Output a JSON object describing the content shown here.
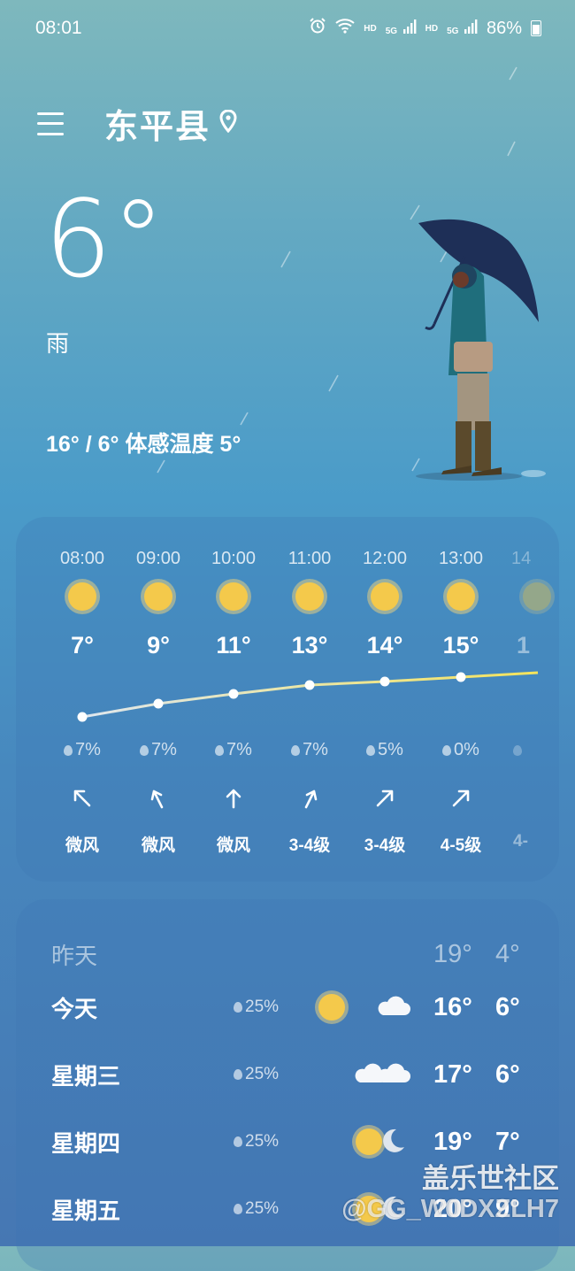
{
  "status_bar": {
    "time": "08:01",
    "hd1": "HD",
    "hd2": "HD",
    "sig1": "5G",
    "sig2": "5G",
    "battery": "86%"
  },
  "header": {
    "city": "东平县"
  },
  "current": {
    "temp": "6°",
    "condition": "雨",
    "range": "16° / 6° 体感温度 5°"
  },
  "hourly": [
    {
      "time": "08:00",
      "temp": "7°",
      "rain": "7%",
      "wind": "微风",
      "wind_dir": "northwest"
    },
    {
      "time": "09:00",
      "temp": "9°",
      "rain": "7%",
      "wind": "微风",
      "wind_dir": "north"
    },
    {
      "time": "10:00",
      "temp": "11°",
      "rain": "7%",
      "wind": "微风",
      "wind_dir": "north"
    },
    {
      "time": "11:00",
      "temp": "13°",
      "rain": "7%",
      "wind": "3-4级",
      "wind_dir": "northeast"
    },
    {
      "time": "12:00",
      "temp": "14°",
      "rain": "5%",
      "wind": "3-4级",
      "wind_dir": "northeast"
    },
    {
      "time": "13:00",
      "temp": "15°",
      "rain": "0%",
      "wind": "4-5级",
      "wind_dir": "northeast"
    },
    {
      "time": "14",
      "temp": "1",
      "rain": "",
      "wind": "4-"
    }
  ],
  "daily": [
    {
      "day": "昨天",
      "rain": "",
      "hi": "19°",
      "lo": "4°"
    },
    {
      "day": "今天",
      "rain": "25%",
      "icon1": "sun-icon",
      "icon2": "cloud-icon",
      "hi": "16°",
      "lo": "6°"
    },
    {
      "day": "星期三",
      "rain": "25%",
      "icon1": "cloud-icon",
      "icon2": "cloud-icon",
      "hi": "17°",
      "lo": "6°"
    },
    {
      "day": "星期四",
      "rain": "25%",
      "icon1": "sun-icon",
      "icon2": "moon-icon",
      "hi": "19°",
      "lo": "7°"
    },
    {
      "day": "星期五",
      "rain": "25%",
      "icon1": "sun-icon",
      "icon2": "moon-icon",
      "hi": "20°",
      "lo": "9°"
    }
  ],
  "watermark": {
    "brand": "盖乐世社区",
    "user": "@GG_W0DXZLH7"
  },
  "colors": {
    "sun": "#f4c94b",
    "temp_line_start": "#dfe7ef",
    "temp_line_end": "#f5e45a"
  }
}
